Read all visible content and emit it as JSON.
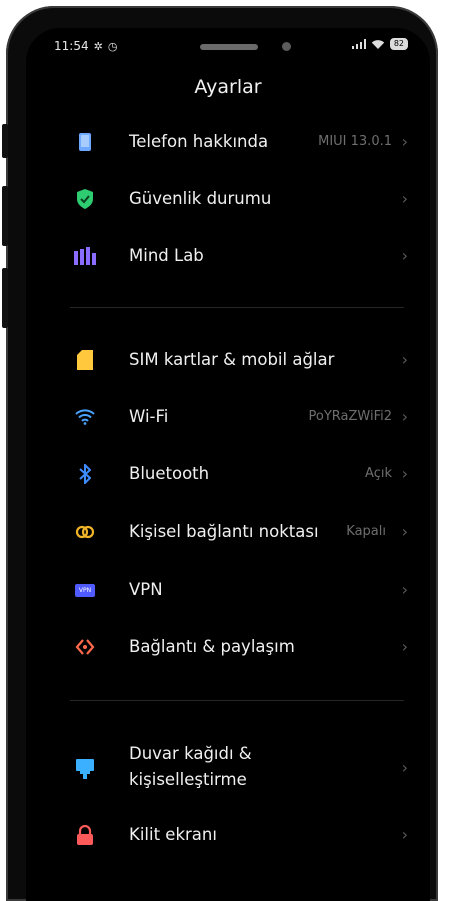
{
  "status": {
    "time": "11:54",
    "battery": "82"
  },
  "header": {
    "title": "Ayarlar"
  },
  "items": [
    {
      "label": "Telefon hakkında",
      "value": "MIUI 13.0.1",
      "icon": "phone-info-icon",
      "color": "#6fa8ff"
    },
    {
      "label": "Güvenlik durumu",
      "value": "",
      "icon": "shield-check-icon",
      "color": "#2ecc71"
    },
    {
      "label": "Mind Lab",
      "value": "",
      "icon": "mind-lab-icon",
      "color": "#8a6cff"
    },
    {
      "label": "SIM kartlar & mobil ağlar",
      "value": "",
      "icon": "sim-card-icon",
      "color": "#ffc83d"
    },
    {
      "label": "Wi-Fi",
      "value": "PoYRaZWiFi2",
      "icon": "wifi-icon",
      "color": "#4aa3ff"
    },
    {
      "label": "Bluetooth",
      "value": "Açık",
      "icon": "bluetooth-icon",
      "color": "#3f8cff"
    },
    {
      "label": "Kişisel bağlantı noktası",
      "value": "Kapalı",
      "icon": "hotspot-icon",
      "color": "#f0b429"
    },
    {
      "label": "VPN",
      "value": "",
      "icon": "vpn-icon",
      "color": "#4f5bff",
      "badge": "VPN"
    },
    {
      "label": "Bağlantı & paylaşım",
      "value": "",
      "icon": "connection-share-icon",
      "color": "#ff6a4d"
    },
    {
      "label_line1": "Duvar kağıdı &",
      "label_line2": "kişiselleştirme",
      "value": "",
      "icon": "wallpaper-icon",
      "color": "#3ab0ff"
    },
    {
      "label": "Kilit ekranı",
      "value": "",
      "icon": "lock-icon",
      "color": "#ff5a5a"
    }
  ]
}
